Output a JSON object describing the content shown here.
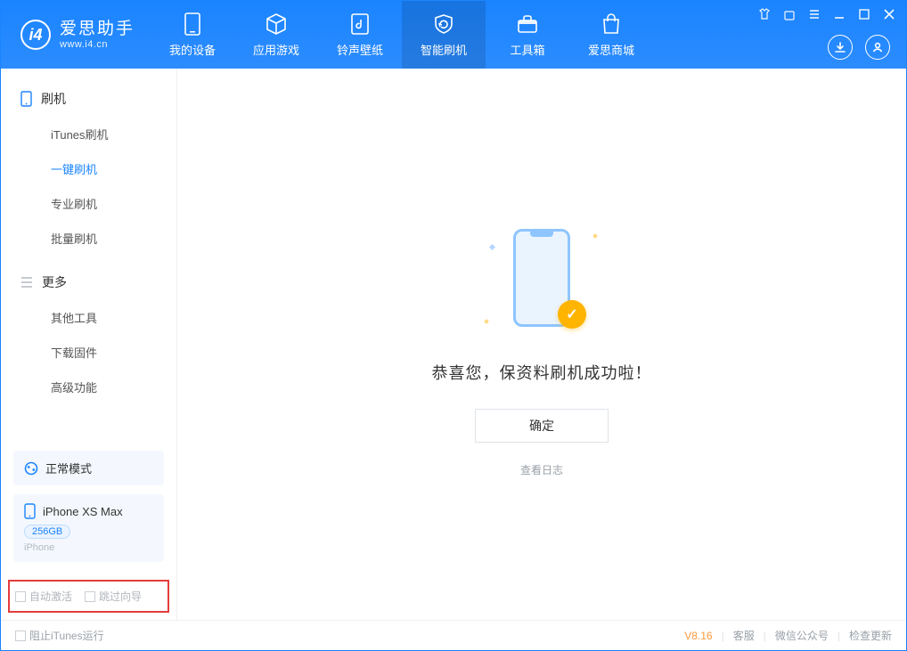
{
  "app": {
    "name": "爱思助手",
    "site": "www.i4.cn"
  },
  "nav": {
    "items": [
      {
        "label": "我的设备"
      },
      {
        "label": "应用游戏"
      },
      {
        "label": "铃声壁纸"
      },
      {
        "label": "智能刷机"
      },
      {
        "label": "工具箱"
      },
      {
        "label": "爱思商城"
      }
    ],
    "active_index": 3
  },
  "sidebar": {
    "group_flash": "刷机",
    "items_flash": [
      {
        "label": "iTunes刷机"
      },
      {
        "label": "一键刷机"
      },
      {
        "label": "专业刷机"
      },
      {
        "label": "批量刷机"
      }
    ],
    "active_flash_index": 1,
    "group_more": "更多",
    "items_more": [
      {
        "label": "其他工具"
      },
      {
        "label": "下载固件"
      },
      {
        "label": "高级功能"
      }
    ]
  },
  "device": {
    "mode_label": "正常模式",
    "model": "iPhone XS Max",
    "storage": "256GB",
    "type": "iPhone"
  },
  "options": {
    "auto_activate": "自动激活",
    "skip_guide": "跳过向导"
  },
  "main": {
    "success_msg": "恭喜您，保资料刷机成功啦！",
    "ok_label": "确定",
    "view_log": "查看日志"
  },
  "footer": {
    "block_itunes": "阻止iTunes运行",
    "version": "V8.16",
    "links": [
      "客服",
      "微信公众号",
      "检查更新"
    ]
  }
}
